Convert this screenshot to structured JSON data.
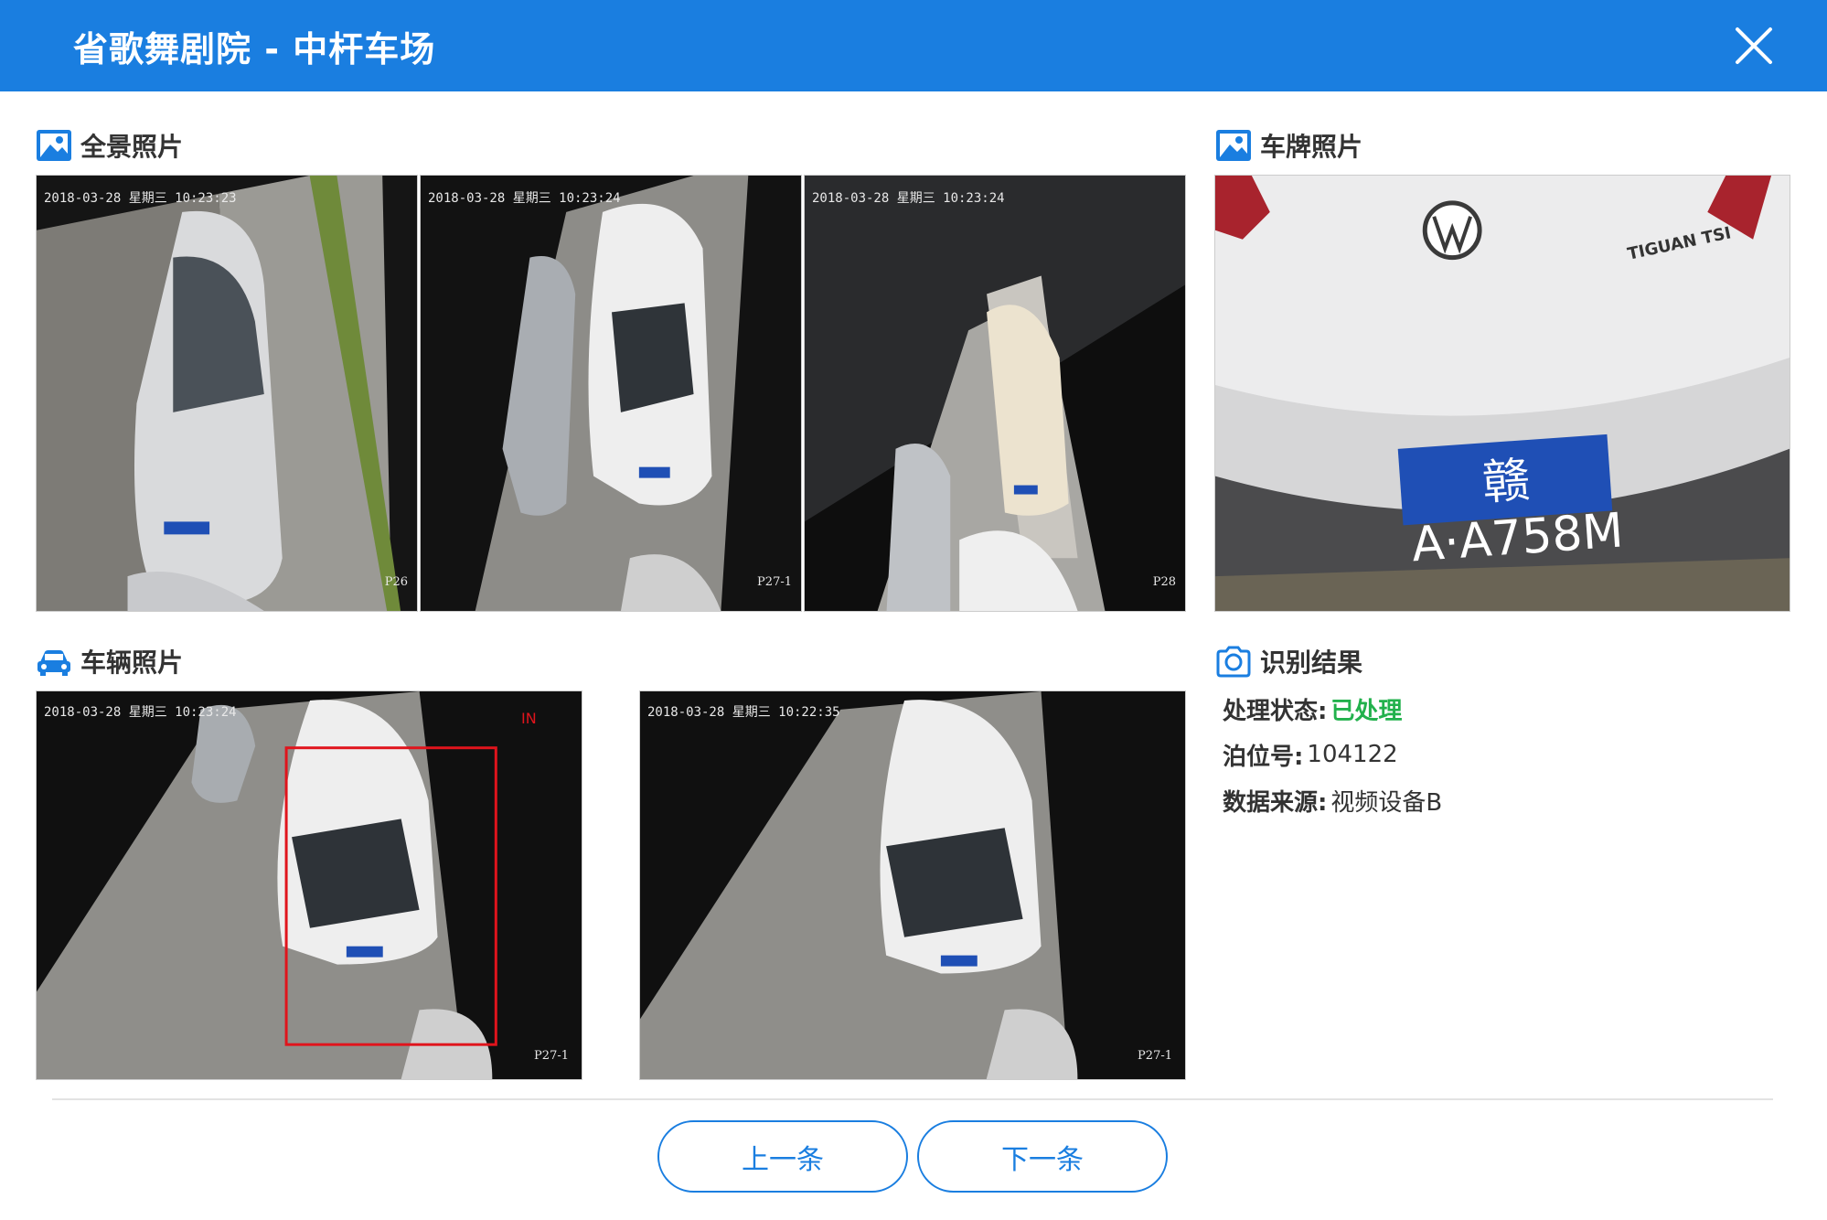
{
  "header": {
    "title": "省歌舞剧院 - 中杆车场"
  },
  "sections": {
    "panorama": {
      "label": "全景照片",
      "icon": "image-icon"
    },
    "plate": {
      "label": "车牌照片",
      "icon": "image-icon"
    },
    "vehicle": {
      "label": "车辆照片",
      "icon": "car-icon"
    },
    "result": {
      "label": "识别结果",
      "icon": "camera-icon"
    }
  },
  "panorama_photos": [
    {
      "stamp": "2018-03-28  星期三  10:23:23",
      "camera": "P26"
    },
    {
      "stamp": "2018-03-28  星期三  10:23:24",
      "camera": "P27-1"
    },
    {
      "stamp": "2018-03-28  星期三  10:23:24",
      "camera": "P28"
    }
  ],
  "plate_photo": {
    "plate_text": "赣A·A758M",
    "badge": "TIGUAN TSI"
  },
  "vehicle_photos": [
    {
      "stamp": "2018-03-28  星期三  10:23:24",
      "camera": "P27-1",
      "marker": "IN"
    },
    {
      "stamp": "2018-03-28  星期三  10:22:35",
      "camera": "P27-1"
    }
  ],
  "result": {
    "status_label": "处理状态:",
    "status_value": "已处理",
    "berth_label": "泊位号:",
    "berth_value": "104122",
    "source_label": "数据来源:",
    "source_value": "视频设备B"
  },
  "buttons": {
    "prev": "上一条",
    "next": "下一条"
  },
  "colors": {
    "primary": "#1a7ee0",
    "success": "#22b14c",
    "box": "#e0141c"
  }
}
